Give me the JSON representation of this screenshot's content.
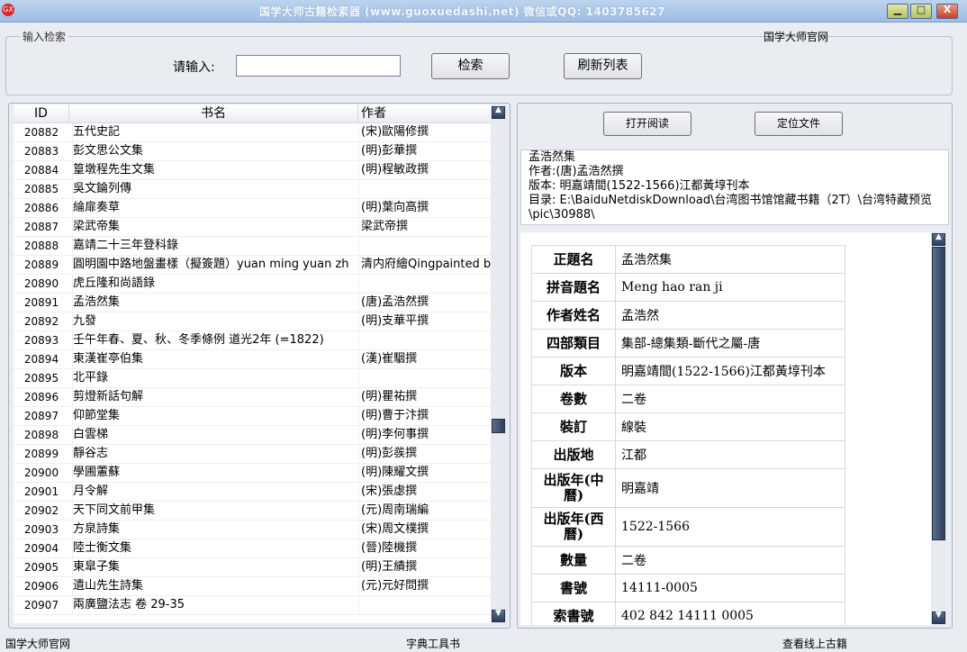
{
  "window": {
    "title": "国学大师古籍检索器 (www.guoxuedashi.net)      微信或QQ: 1403785627",
    "app_icon_text": "GX",
    "controls": {
      "minimize": "▁",
      "maximize": "□",
      "close": "X"
    }
  },
  "search": {
    "legend": "输入检索",
    "label": "请输入:",
    "value": "",
    "search_button": "检索",
    "refresh_button": "刷新列表",
    "official_site_link": "国学大师官网"
  },
  "list": {
    "headers": {
      "id": "ID",
      "title": "书名",
      "author": "作者"
    },
    "rows": [
      {
        "id": "20882",
        "title": "五代史記",
        "author": "(宋)歐陽修撰"
      },
      {
        "id": "20883",
        "title": "彭文思公文集",
        "author": "(明)彭華撰"
      },
      {
        "id": "20884",
        "title": "篁墩程先生文集",
        "author": "(明)程敏政撰"
      },
      {
        "id": "20885",
        "title": "吳文錀列傳",
        "author": ""
      },
      {
        "id": "20886",
        "title": "綸扉奏草",
        "author": "(明)葉向高撰"
      },
      {
        "id": "20887",
        "title": "梁武帝集",
        "author": "梁武帝撰"
      },
      {
        "id": "20888",
        "title": "嘉靖二十三年登科錄",
        "author": ""
      },
      {
        "id": "20889",
        "title": "圓明園中路地盤畫樣（擬簽題）yuan ming yuan zh",
        "author": "清内府繪Qingpainted by"
      },
      {
        "id": "20890",
        "title": "虎丘隆和尚語錄",
        "author": ""
      },
      {
        "id": "20891",
        "title": "孟浩然集",
        "author": "(唐)孟浩然撰"
      },
      {
        "id": "20892",
        "title": "九發",
        "author": "(明)支華平撰"
      },
      {
        "id": "20893",
        "title": "壬午年春、夏、秋、冬季條例 道光2年 (=1822)",
        "author": ""
      },
      {
        "id": "20894",
        "title": "東漢崔亭伯集",
        "author": "(漢)崔駰撰"
      },
      {
        "id": "20895",
        "title": "北平錄",
        "author": ""
      },
      {
        "id": "20896",
        "title": "剪燈新話句解",
        "author": "(明)瞿祐撰"
      },
      {
        "id": "20897",
        "title": "仰節堂集",
        "author": "(明)曹于汴撰"
      },
      {
        "id": "20898",
        "title": "白雲梯",
        "author": "(明)李何事撰"
      },
      {
        "id": "20899",
        "title": "靜谷志",
        "author": "(明)彭彂撰"
      },
      {
        "id": "20900",
        "title": "學圃藼蘇",
        "author": "(明)陳耀文撰"
      },
      {
        "id": "20901",
        "title": "月令解",
        "author": "(宋)張虙撰"
      },
      {
        "id": "20902",
        "title": "天下同文前甲集",
        "author": "(元)周南瑞編"
      },
      {
        "id": "20903",
        "title": "方泉詩集",
        "author": "(宋)周文樸撰"
      },
      {
        "id": "20904",
        "title": "陸士衡文集",
        "author": "(晉)陸機撰"
      },
      {
        "id": "20905",
        "title": "東皐子集",
        "author": "(明)王績撰"
      },
      {
        "id": "20906",
        "title": "遺山先生詩集",
        "author": "(元)元好問撰"
      },
      {
        "id": "20907",
        "title": "兩廣鹽法志 卷 29-35",
        "author": ""
      }
    ]
  },
  "actions": {
    "open_read": "打开阅读",
    "locate_file": "定位文件"
  },
  "info": {
    "title": "孟浩然集",
    "author": "作者:(唐)孟浩然撰",
    "edition": "版本: 明嘉靖間(1522-1566)江都黃埻刊本",
    "directory": "目录: E:\\BaiduNetdiskDownload\\台湾图书馆馆藏书籍（2T）\\台湾特藏预览\\pic\\30988\\"
  },
  "details": [
    {
      "key": "正題名",
      "value": "孟浩然集"
    },
    {
      "key": "拼音題名",
      "value": "Meng hao ran ji"
    },
    {
      "key": "作者姓名",
      "value": "孟浩然"
    },
    {
      "key": "四部類目",
      "value": "集部-總集類-斷代之屬-唐"
    },
    {
      "key": "版本",
      "value": "明嘉靖間(1522-1566)江都黃埻刊本"
    },
    {
      "key": "卷數",
      "value": "二卷"
    },
    {
      "key": "裝訂",
      "value": "線裝"
    },
    {
      "key": "出版地",
      "value": "江都"
    },
    {
      "key": "出版年(中曆)",
      "value": "明嘉靖"
    },
    {
      "key": "出版年(西曆)",
      "value": "1522-1566"
    },
    {
      "key": "數量",
      "value": "二卷"
    },
    {
      "key": "書號",
      "value": "14111-0005"
    },
    {
      "key": "索書號",
      "value": "402 842 14111 0005"
    }
  ],
  "statusbar": {
    "left": "国学大师官网",
    "center": "字典工具书",
    "right": "查看线上古籍"
  }
}
